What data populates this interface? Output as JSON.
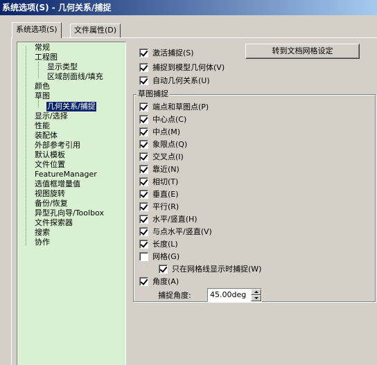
{
  "window": {
    "title": "系统选项(S) - 几何关系/捕捉"
  },
  "tabs": [
    {
      "label": "系统选项(S)",
      "active": true
    },
    {
      "label": "文件属性(D)",
      "active": false
    }
  ],
  "tree": {
    "items": [
      {
        "label": "常规"
      },
      {
        "label": "工程图"
      },
      {
        "label": "显示类型"
      },
      {
        "label": "区域剖面线/填充"
      },
      {
        "label": "颜色"
      },
      {
        "label": "草图"
      },
      {
        "label": "几何关系/捕捉",
        "selected": true
      },
      {
        "label": "显示/选择"
      },
      {
        "label": "性能"
      },
      {
        "label": "装配体"
      },
      {
        "label": "外部参考引用"
      },
      {
        "label": "默认模板"
      },
      {
        "label": "文件位置"
      },
      {
        "label": "FeatureManager"
      },
      {
        "label": "选值框增量值"
      },
      {
        "label": "视图旋转"
      },
      {
        "label": "备份/恢复"
      },
      {
        "label": "异型孔向导/Toolbox"
      },
      {
        "label": "文件探索器"
      },
      {
        "label": "搜索"
      },
      {
        "label": "协作"
      }
    ]
  },
  "top_options": [
    {
      "label": "激活捕捉(S)",
      "checked": true
    },
    {
      "label": "捕捉到模型几何体(V)",
      "checked": true
    },
    {
      "label": "自动几何关系(U)",
      "checked": true
    }
  ],
  "grid_button": {
    "label": "转到文档网格设定"
  },
  "sketch_snaps": {
    "title": "草图捕捉",
    "options": [
      {
        "label": "端点和草图点(P)",
        "checked": true
      },
      {
        "label": "中心点(C)",
        "checked": true
      },
      {
        "label": "中点(M)",
        "checked": true
      },
      {
        "label": "象限点(Q)",
        "checked": true
      },
      {
        "label": "交叉点(I)",
        "checked": true
      },
      {
        "label": "靠近(N)",
        "checked": true
      },
      {
        "label": "相切(T)",
        "checked": true
      },
      {
        "label": "垂直(E)",
        "checked": true
      },
      {
        "label": "平行(R)",
        "checked": true
      },
      {
        "label": "水平/竖直(H)",
        "checked": true
      },
      {
        "label": "与点水平/竖直(V)",
        "checked": true
      },
      {
        "label": "长度(L)",
        "checked": true
      },
      {
        "label": "网格(G)",
        "checked": false
      },
      {
        "label": "只在网格线显示时捕捉(W)",
        "checked": true
      },
      {
        "label": "角度(A)",
        "checked": true
      }
    ],
    "angle_label": "捕捉角度:",
    "angle_value": "45.00deg"
  }
}
